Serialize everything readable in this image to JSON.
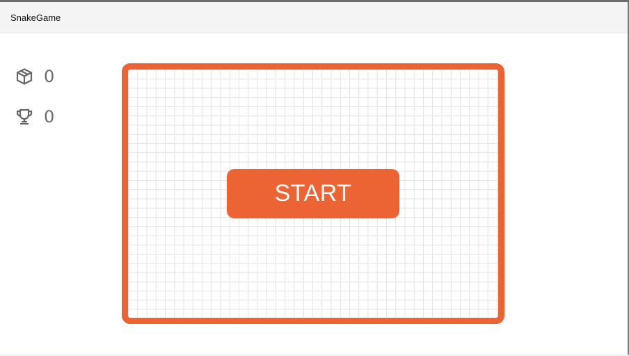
{
  "window": {
    "title": "SnakeGame"
  },
  "stats": {
    "score": {
      "icon": "box-icon",
      "value": "0"
    },
    "best": {
      "icon": "trophy-icon",
      "value": "0"
    }
  },
  "board": {
    "start_label": "START"
  },
  "colors": {
    "accent": "#ec6434",
    "grid_line": "#e3e3e3",
    "stat_text": "#6a6a6a",
    "titlebar_bg": "#f4f4f4"
  }
}
